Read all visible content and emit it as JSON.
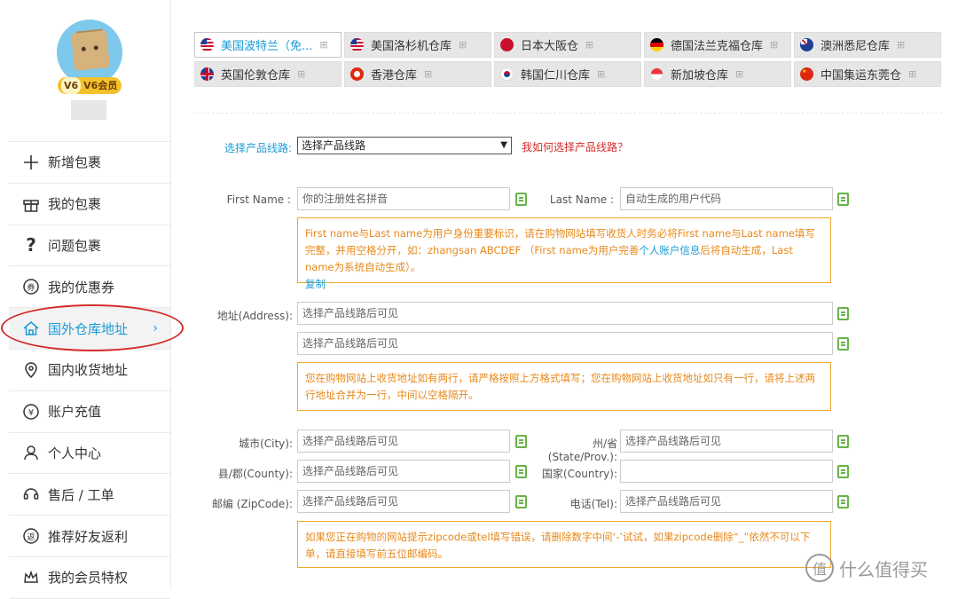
{
  "user": {
    "vip_level": "V6",
    "vip_label": "V6会员"
  },
  "menu": [
    {
      "label": "新增包裹",
      "icon": "plus-icon"
    },
    {
      "label": "我的包裹",
      "icon": "gift-box-icon"
    },
    {
      "label": "问题包裹",
      "icon": "question-icon"
    },
    {
      "label": "我的优惠券",
      "icon": "coupon-icon"
    },
    {
      "label": "国外仓库地址",
      "icon": "home-icon",
      "active": true
    },
    {
      "label": "国内收货地址",
      "icon": "location-pin-icon"
    },
    {
      "label": "账户充值",
      "icon": "yen-icon"
    },
    {
      "label": "个人中心",
      "icon": "user-icon"
    },
    {
      "label": "售后 / 工单",
      "icon": "headset-icon"
    },
    {
      "label": "推荐好友返利",
      "icon": "rebate-icon"
    },
    {
      "label": "我的会员特权",
      "icon": "crown-icon"
    }
  ],
  "tabs": [
    {
      "label": "美国波特兰（免...",
      "flag": "us",
      "active": true
    },
    {
      "label": "美国洛杉机仓库",
      "flag": "us"
    },
    {
      "label": "日本大阪仓",
      "flag": "jp"
    },
    {
      "label": "德国法兰克福仓库",
      "flag": "de"
    },
    {
      "label": "澳洲悉尼仓库",
      "flag": "au"
    },
    {
      "label": "英国伦敦仓库",
      "flag": "uk"
    },
    {
      "label": "香港仓库",
      "flag": "hk"
    },
    {
      "label": "韩国仁川仓库",
      "flag": "kr"
    },
    {
      "label": "新加坡仓库",
      "flag": "sg"
    },
    {
      "label": "中国集运东莞仓",
      "flag": "cn"
    }
  ],
  "form": {
    "line_label": "选择产品线路:",
    "line_value": "选择产品线路",
    "line_help": "我如何选择产品线路？",
    "first_name_label": "First Name :",
    "first_name_placeholder": "你的注册姓名拼音",
    "last_name_label": "Last Name :",
    "last_name_placeholder": "自动生成的用户代码",
    "name_note_a": "First name与Last name为用户身份重要标识，请在购物网站填写收货人时务必将First name与Last name填写完整，并用空格分开，如：zhangsan ABCDEF （First name为用户完善",
    "name_note_link": "个人账户信息",
    "name_note_b": "后将自动生成，Last name为系统自动生成）。",
    "name_note_copy": "复制",
    "address_label": "地址(Address):",
    "address1_value": "选择产品线路后可见",
    "address2_value": "选择产品线路后可见",
    "address_note": "您在购物网站上收货地址如有两行，请严格按照上方格式填写；您在购物网站上收货地址如只有一行，请将上述两行地址合并为一行，中间以空格隔开。",
    "city_label": "城市(City):",
    "city_value": "选择产品线路后可见",
    "state_label": "州/省(State/Prov.):",
    "state_value": "选择产品线路后可见",
    "county_label": "县/郡(County):",
    "county_value": "选择产品线路后可见",
    "country_label": "国家(Country):",
    "country_value": "",
    "zip_label": "邮编 (ZipCode):",
    "zip_value": "选择产品线路后可见",
    "tel_label": "电话(Tel):",
    "tel_value": "选择产品线路后可见",
    "zip_note": "如果您正在购物的网站提示zipcode或tel填写错误，请删除数字中间‘-’试试，如果zipcode删除“_”依然不可以下单，请直接填写前五位邮编码。"
  },
  "watermark": {
    "text": "什么值得买",
    "icon": "smzdm-logo-icon"
  },
  "colors": {
    "accent": "#1a9bd7",
    "note_border": "#f0a830",
    "note_text": "#e8891a",
    "copy_green": "#67b346",
    "highlight_red": "#d42b2b"
  }
}
